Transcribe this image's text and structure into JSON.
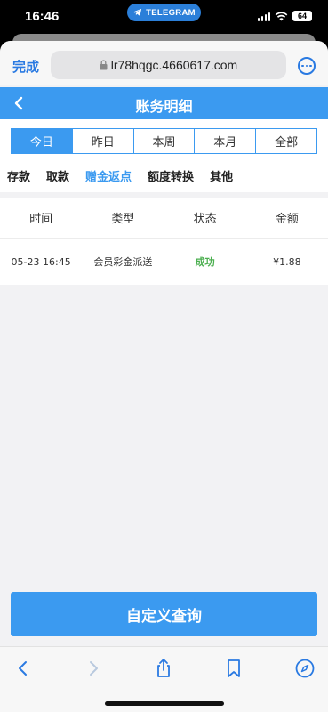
{
  "status_bar": {
    "time": "16:46",
    "pill_label": "TELEGRAM",
    "battery": "64"
  },
  "browser": {
    "done_label": "完成",
    "url": "lr78hqgc.4660617.com",
    "accent_color": "#2a7ae2"
  },
  "header": {
    "title": "账务明细",
    "background_color": "#3b9af0"
  },
  "date_tabs": [
    {
      "label": "今日",
      "active": true
    },
    {
      "label": "昨日",
      "active": false
    },
    {
      "label": "本周",
      "active": false
    },
    {
      "label": "本月",
      "active": false
    },
    {
      "label": "全部",
      "active": false
    }
  ],
  "categories": [
    {
      "label": "存款",
      "active": false
    },
    {
      "label": "取款",
      "active": false
    },
    {
      "label": "赠金返点",
      "active": true
    },
    {
      "label": "额度转换",
      "active": false
    },
    {
      "label": "其他",
      "active": false
    }
  ],
  "table": {
    "headers": [
      "时间",
      "类型",
      "状态",
      "金额"
    ],
    "rows": [
      {
        "time": "05-23 16:45",
        "type": "会员彩金派送",
        "status": "成功",
        "amount": "¥1.88"
      }
    ]
  },
  "query_button": {
    "label": "自定义查询"
  },
  "toolbar_icons": [
    "back-icon",
    "forward-icon",
    "share-icon",
    "bookmarks-icon",
    "compass-icon"
  ]
}
